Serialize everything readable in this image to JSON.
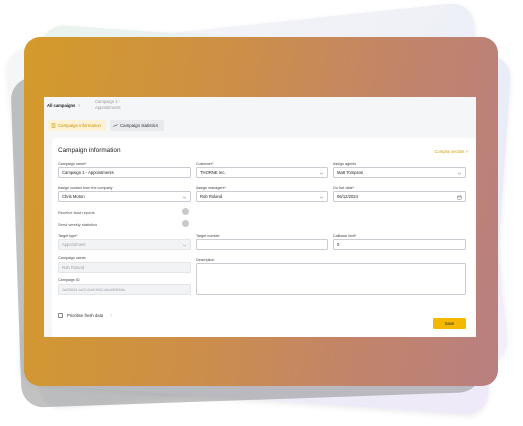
{
  "breadcrumb": {
    "home": "All campaigns",
    "separator": ">",
    "current": "Campaign 1 - Appointments"
  },
  "tabs": [
    {
      "label": "Campaign information",
      "active": true,
      "icon": "document-icon"
    },
    {
      "label": "Campaign statistics",
      "active": false,
      "icon": "chart-icon"
    }
  ],
  "panel": {
    "title": "Campaign information",
    "link": "Compse section >"
  },
  "form": {
    "campaign_name": {
      "label": "Campaign name*",
      "value": "Campaign 1 - Appointments"
    },
    "customer": {
      "label": "Customer*",
      "value": "THORNE Inc."
    },
    "assign_agents": {
      "label": "Assign agents",
      "value": "Matt Tompson"
    },
    "assign_contact": {
      "label": "Assign contact from the company",
      "value": "Chris Moton"
    },
    "assign_managers": {
      "label": "Assign managers*",
      "value": "Rob Roland"
    },
    "go_live_date": {
      "label": "Go live date*",
      "value": "06/12/2024"
    },
    "receive_lead_reports": {
      "label": "Receive lead reports"
    },
    "send_weekly_statistics": {
      "label": "Send weekly statistics"
    },
    "target_type": {
      "label": "Target type*",
      "value": "Appointment"
    },
    "target_number": {
      "label": "Target number",
      "value": ""
    },
    "callback_limit": {
      "label": "Callback limit*",
      "value": "0"
    },
    "campaign_owner": {
      "label": "Campaign owner",
      "value": "Rob Roland"
    },
    "campaign_id": {
      "label": "Campaign ID",
      "value": "2a403064-1a23-41a9-9602-d6cb0b9f4dfa"
    },
    "description": {
      "label": "Description",
      "value": ""
    },
    "prioritise": {
      "label": "Prioritise fresh data",
      "help": "?"
    }
  },
  "actions": {
    "save": "Save"
  },
  "colors": {
    "accent": "#f5b800",
    "frame_gradient_start": "#d49a2a",
    "frame_gradient_end": "#b97f80"
  }
}
